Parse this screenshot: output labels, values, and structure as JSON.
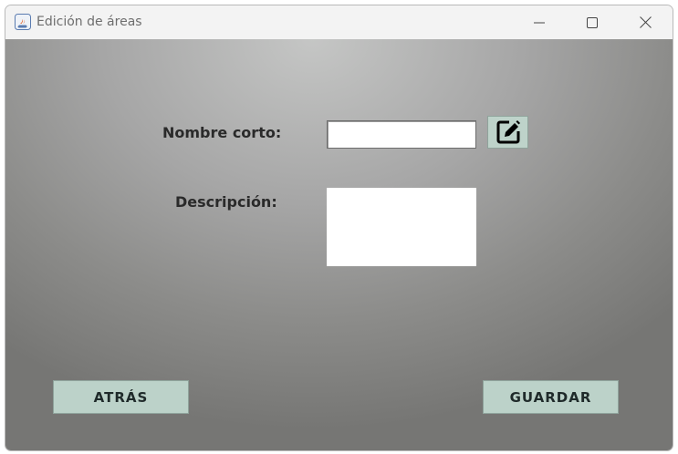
{
  "window": {
    "title": "Edición de áreas"
  },
  "form": {
    "short_name_label": "Nombre corto:",
    "short_name_value": "",
    "description_label": "Descripción:",
    "description_value": ""
  },
  "buttons": {
    "edit_icon": "edit-pencil-icon",
    "back_label": "ATRÁS",
    "save_label": "GUARDAR"
  },
  "colors": {
    "button_bg": "#bcd2c9",
    "background_center": "#c5c6c5",
    "background_edge": "#767674"
  }
}
